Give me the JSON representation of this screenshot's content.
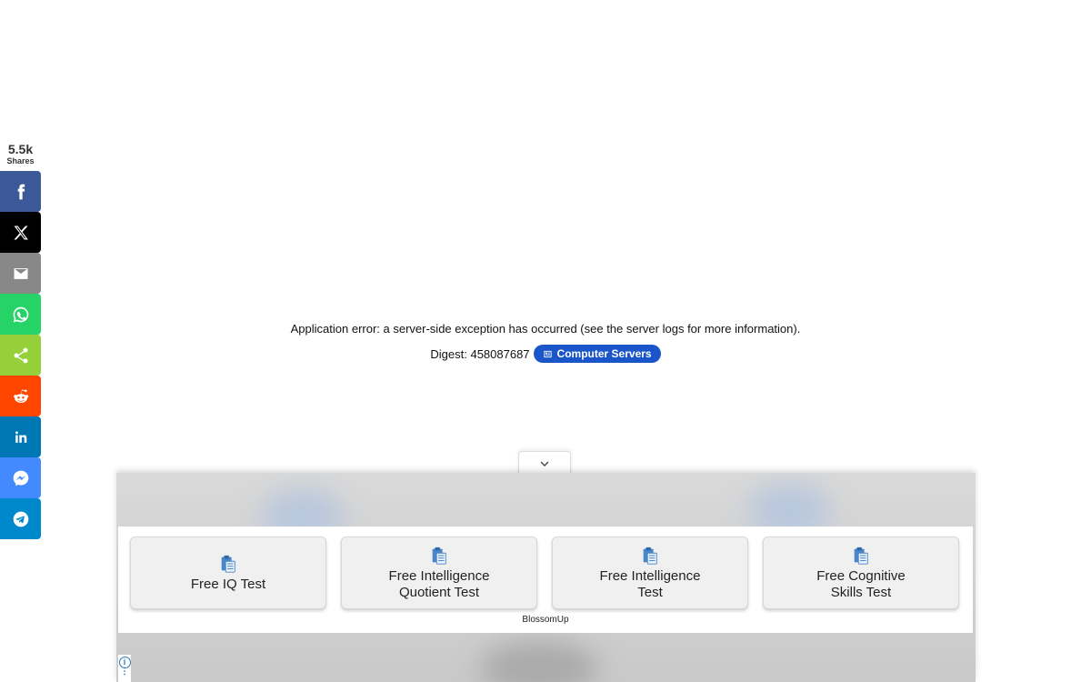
{
  "share": {
    "count": "5.5k",
    "count_label": "Shares",
    "buttons": [
      {
        "network": "facebook",
        "icon": "facebook-icon",
        "color": "#3b5998"
      },
      {
        "network": "x",
        "icon": "x-icon",
        "color": "#000000"
      },
      {
        "network": "email",
        "icon": "email-icon",
        "color": "#888888"
      },
      {
        "network": "whatsapp",
        "icon": "whatsapp-icon",
        "color": "#25d366"
      },
      {
        "network": "share",
        "icon": "share-icon",
        "color": "#95d03a"
      },
      {
        "network": "reddit",
        "icon": "reddit-icon",
        "color": "#ff4500"
      },
      {
        "network": "linkedin",
        "icon": "linkedin-icon",
        "color": "#0077b5"
      },
      {
        "network": "messenger",
        "icon": "messenger-icon",
        "color": "#448aff"
      },
      {
        "network": "telegram",
        "icon": "telegram-icon",
        "color": "#0088cc"
      }
    ]
  },
  "error": {
    "message": "Application error: a server-side exception has occurred (see the server logs for more information).",
    "digest_label": "Digest: 458087687",
    "pill_label": "Computer Servers",
    "pill_color": "#1a56c9"
  },
  "ad": {
    "cards": [
      {
        "label": "Free IQ Test",
        "icon": "clipboard-icon"
      },
      {
        "label": "Free Intelligence\nQuotient Test",
        "icon": "clipboard-icon"
      },
      {
        "label": "Free Intelligence\nTest",
        "icon": "clipboard-icon"
      },
      {
        "label": "Free Cognitive\nSkills Test",
        "icon": "clipboard-icon"
      }
    ],
    "source": "BlossomUp"
  }
}
